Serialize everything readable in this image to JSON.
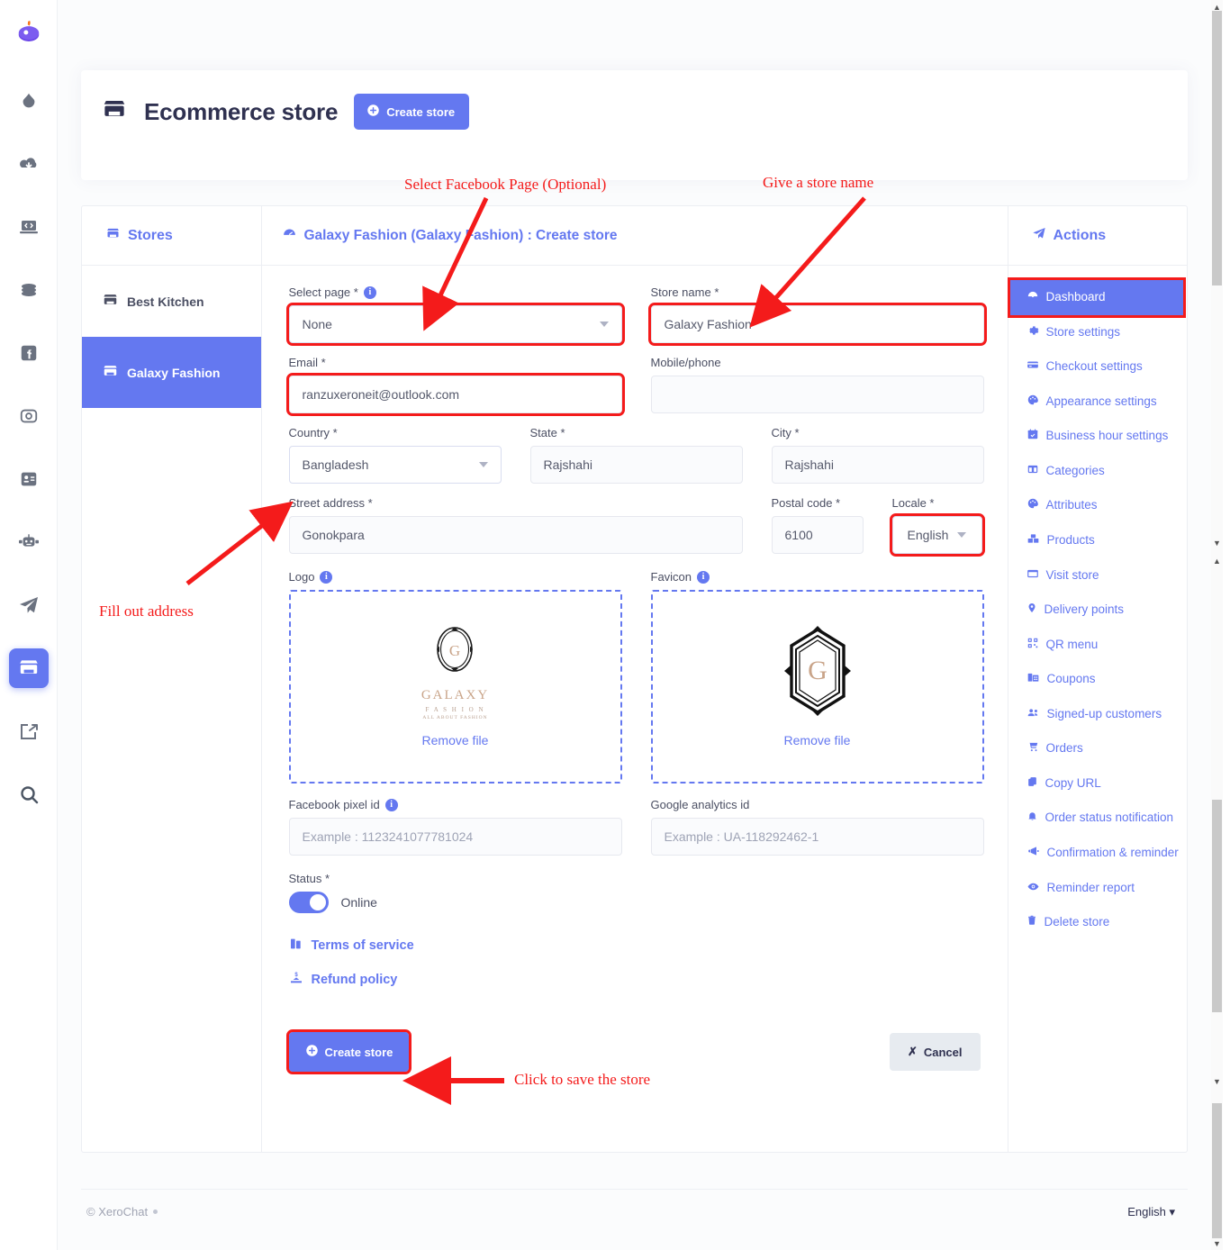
{
  "topbar": {
    "hamburger": "menu-toggle",
    "bell": "notifications",
    "avatar": "user-avatar"
  },
  "header": {
    "title": "Ecommerce store",
    "create_button": "Create store"
  },
  "stores_panel": {
    "heading": "Stores",
    "items": [
      {
        "label": "Best Kitchen",
        "active": false
      },
      {
        "label": "Galaxy Fashion",
        "active": true
      }
    ]
  },
  "form": {
    "heading": "Galaxy Fashion (Galaxy Fashion) : Create store",
    "select_page": {
      "label": "Select page *",
      "value": "None"
    },
    "store_name": {
      "label": "Store name *",
      "value": "Galaxy Fashion"
    },
    "email": {
      "label": "Email *",
      "value": "ranzuxeroneit@outlook.com"
    },
    "mobile": {
      "label": "Mobile/phone",
      "value": ""
    },
    "country": {
      "label": "Country *",
      "value": "Bangladesh"
    },
    "state": {
      "label": "State *",
      "value": "Rajshahi"
    },
    "city": {
      "label": "City *",
      "value": "Rajshahi"
    },
    "street": {
      "label": "Street address *",
      "value": "Gonokpara"
    },
    "postal": {
      "label": "Postal code *",
      "value": "6100"
    },
    "locale": {
      "label": "Locale *",
      "value": "English"
    },
    "logo": {
      "label": "Logo",
      "remove": "Remove file",
      "brand": "GALAXY",
      "brand_sub": "F A S H I O N",
      "brand_sub2": "ALL ABOUT FASHION",
      "monogram": "G"
    },
    "favicon": {
      "label": "Favicon",
      "remove": "Remove file",
      "monogram": "G"
    },
    "fb_pixel": {
      "label": "Facebook pixel id",
      "placeholder": "Example : 1123241077781024",
      "value": ""
    },
    "ga_id": {
      "label": "Google analytics id",
      "placeholder": "Example : UA-118292462-1",
      "value": ""
    },
    "status": {
      "label": "Status *",
      "toggle_label": "Online",
      "on": true
    },
    "terms_link": "Terms of service",
    "refund_link": "Refund policy",
    "submit_button": "Create store",
    "cancel_button": "Cancel"
  },
  "actions": {
    "heading": "Actions",
    "items": [
      {
        "label": "Dashboard",
        "icon": "dashboard-icon",
        "active": true
      },
      {
        "label": "Store settings",
        "icon": "gear-icon",
        "active": false
      },
      {
        "label": "Checkout settings",
        "icon": "credit-card-icon",
        "active": false
      },
      {
        "label": "Appearance settings",
        "icon": "palette-icon",
        "active": false
      },
      {
        "label": "Business hour settings",
        "icon": "calendar-icon",
        "active": false
      },
      {
        "label": "Categories",
        "icon": "columns-icon",
        "active": false
      },
      {
        "label": "Attributes",
        "icon": "palette-icon",
        "active": false
      },
      {
        "label": "Products",
        "icon": "boxes-icon",
        "active": false
      },
      {
        "label": "Visit store",
        "icon": "window-icon",
        "active": false
      },
      {
        "label": "Delivery points",
        "icon": "map-pin-icon",
        "active": false
      },
      {
        "label": "QR menu",
        "icon": "qr-code-icon",
        "active": false
      },
      {
        "label": "Coupons",
        "icon": "ticket-icon",
        "active": false
      },
      {
        "label": "Signed-up customers",
        "icon": "users-icon",
        "active": false
      },
      {
        "label": "Orders",
        "icon": "cart-icon",
        "active": false
      },
      {
        "label": "Copy URL",
        "icon": "copy-icon",
        "active": false
      },
      {
        "label": "Order status notification",
        "icon": "bell-icon",
        "active": false
      },
      {
        "label": "Confirmation & reminder",
        "icon": "megaphone-icon",
        "active": false
      },
      {
        "label": "Reminder report",
        "icon": "eye-icon",
        "active": false
      },
      {
        "label": "Delete store",
        "icon": "trash-icon",
        "active": false
      }
    ]
  },
  "footer": {
    "copyright": "© XeroChat",
    "language": "English"
  },
  "annotations": [
    {
      "text": "Select Facebook Page (Optional)"
    },
    {
      "text": "Give a store name"
    },
    {
      "text": "Fill out address"
    },
    {
      "text": "Click to save the store"
    }
  ],
  "rail_icons": [
    "flame-logo-icon",
    "droplet-icon",
    "cloud-download-icon",
    "laptop-code-icon",
    "coins-icon",
    "facebook-icon",
    "instagram-icon",
    "id-card-icon",
    "robot-icon",
    "telegram-icon",
    "store-icon",
    "share-icon",
    "search-icon"
  ],
  "colors": {
    "accent": "#6478f0",
    "annotation": "#f41b1b",
    "dark_text": "#2f3150"
  }
}
